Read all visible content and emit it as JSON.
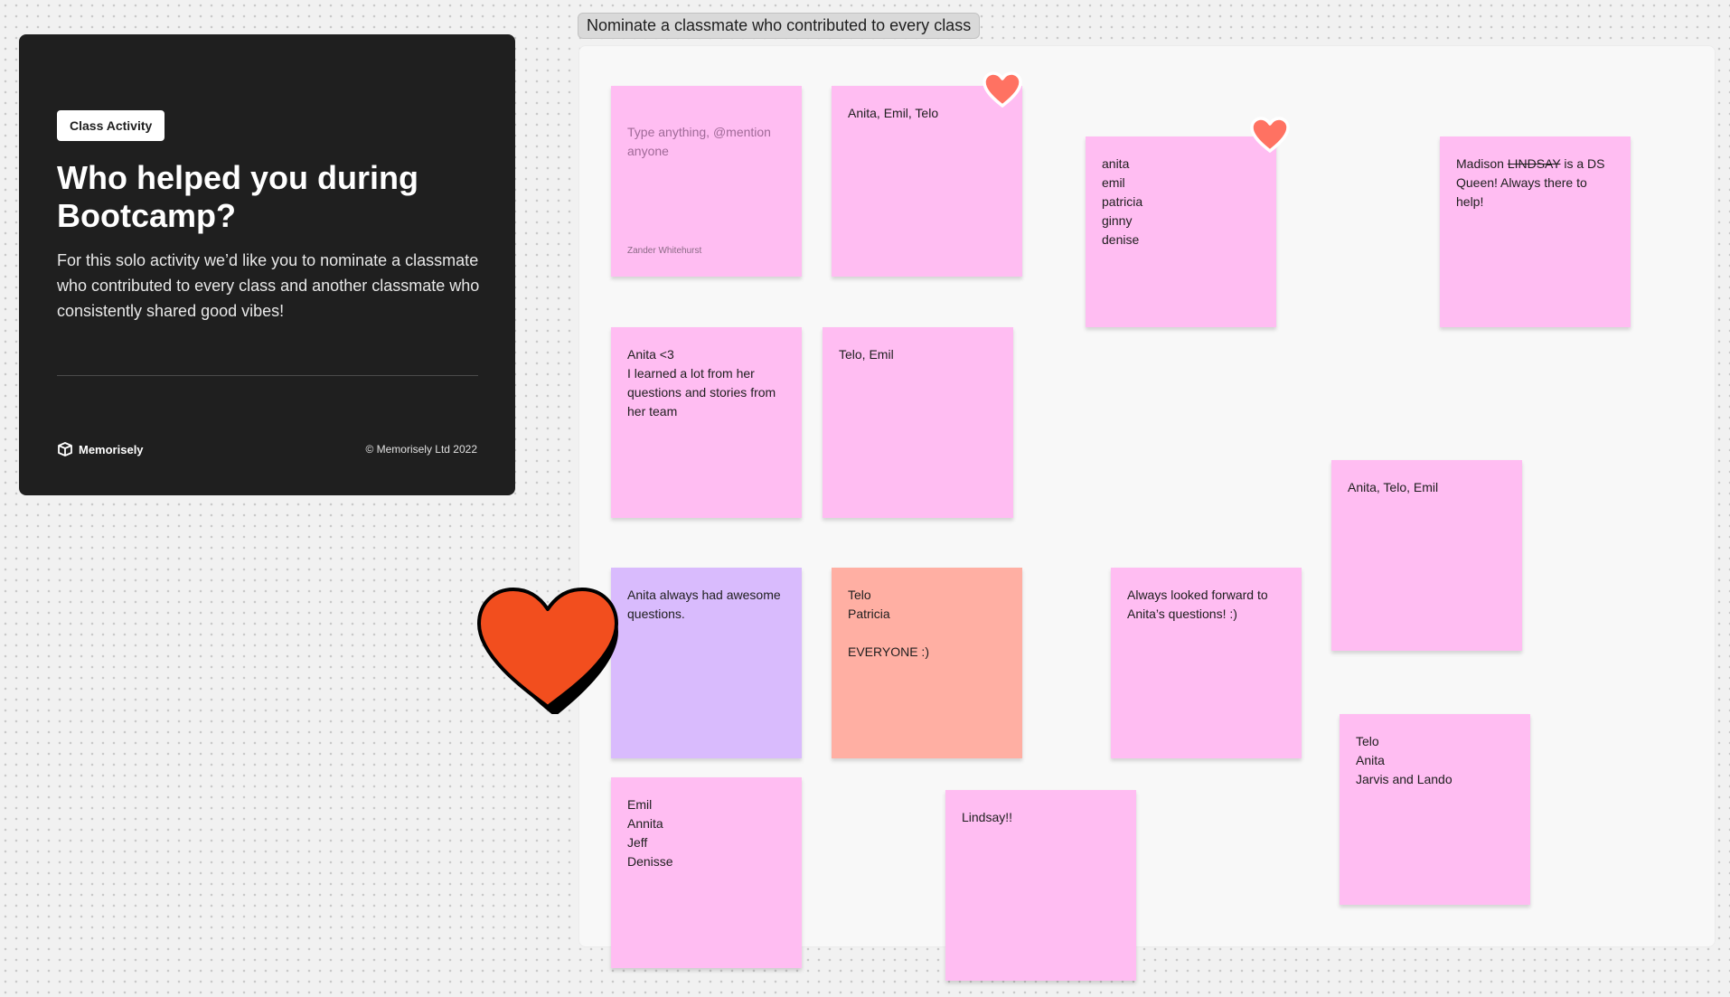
{
  "info_card": {
    "badge": "Class Activity",
    "title": "Who helped you during Bootcamp?",
    "description": "For this solo activity we’d like you to nominate a classmate who contributed to every class and another classmate who consistently shared good vibes!",
    "brand": "Memorisely",
    "copyright": "© Memorisely Ltd 2022"
  },
  "frame": {
    "label": "Nominate a classmate who contributed to every class"
  },
  "notes": {
    "new_note": {
      "placeholder": "Type anything, @mention anyone",
      "author": "Zander Whitehurst"
    },
    "n1": "Anita, Emil, Telo",
    "n2": "anita\nemil\npatricia\nginny\ndenise",
    "n3": {
      "prefix": "Madison ",
      "struck": "LINDSAY",
      "suffix": " is a DS Queen! Always there to help!"
    },
    "n4": "Anita <3\nI learned a lot from her questions and stories from her team",
    "n5": "Telo, Emil",
    "n6": "Anita, Telo, Emil",
    "n7": "Anita always had awesome questions.",
    "n8": "Telo\nPatricia\n\nEVERYONE :)",
    "n9": "Always looked forward to Anita’s questions! :)",
    "n10": "Telo\nAnita\nJarvis and Lando",
    "n11": "Emil\nAnnita\nJeff\nDenisse",
    "n12": "Lindsay!!"
  },
  "colors": {
    "pink_note": "#ffbdf2",
    "purple_note": "#d9bbfd",
    "salmon_note": "#ffafa3",
    "heart_big": "#f24e1e",
    "heart_small": "#ff7262",
    "card_bg": "#1f1f1f"
  },
  "icons": [
    "memorisely-logo-icon",
    "heart-reaction-icon",
    "big-heart-sticker-icon"
  ]
}
